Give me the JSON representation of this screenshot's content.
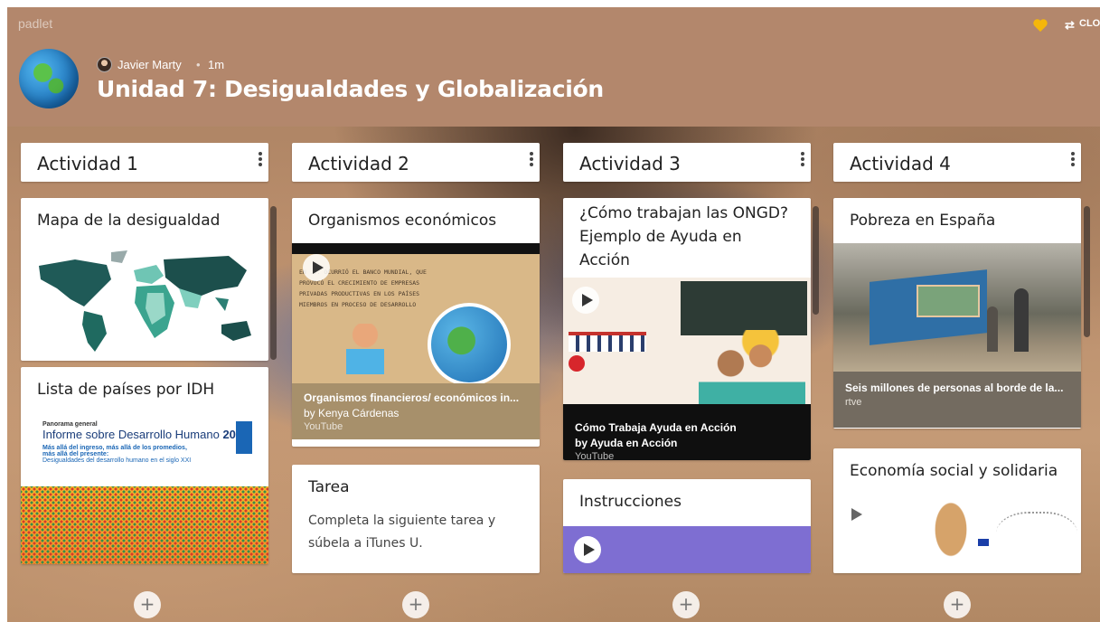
{
  "header": {
    "brand": "padlet",
    "remake_label": "CLO",
    "author": "Javier Marty",
    "separator": "•",
    "time": "1m",
    "title": "Unidad 7: Desigualdades y Globalización"
  },
  "columns": [
    {
      "title": "Actividad 1",
      "posts": [
        {
          "title": "Mapa de la desigualdad"
        },
        {
          "title": "Lista de países por IDH",
          "doc": {
            "kicker": "Panorama general",
            "heading": "Informe sobre Desarrollo Humano",
            "year": "2019",
            "line1": "Más allá del ingreso, más allá de los promedios,",
            "line2": "más allá del presente:",
            "line3": "Desigualdades del desarrollo humano en el siglo XXI"
          }
        }
      ]
    },
    {
      "title": "Actividad 2",
      "posts": [
        {
          "title": "Organismos económicos",
          "video_caption": "Organismos financieros/ económicos in...",
          "by": "by Kenya Cárdenas",
          "source": "YouTube",
          "thumb_text": "En ... ocurrió el Banco Mundial, que provocó el crecimiento de empresas privadas productivas en los países miembros en proceso de desarrollo"
        },
        {
          "title": "Tarea",
          "body": "Completa la siguiente tarea y súbela a iTunes U."
        }
      ]
    },
    {
      "title": "Actividad 3",
      "posts": [
        {
          "title": "¿Cómo trabajan las ONGD? Ejemplo de Ayuda en Acción",
          "video_caption": "Cómo Trabaja Ayuda en Acción",
          "by": "by Ayuda en Acción",
          "source": "YouTube"
        },
        {
          "title": "Instrucciones"
        }
      ]
    },
    {
      "title": "Actividad 4",
      "posts": [
        {
          "title": "Pobreza en España",
          "video_caption": "Seis millones de personas al borde de la...",
          "source": "rtve"
        },
        {
          "title": "Economía social y solidaria"
        }
      ]
    }
  ],
  "add_label": "+",
  "colors": {
    "header": "#b3876c",
    "heart": "#f5b70a",
    "audio_bar": "#7e6ed2",
    "video_bar": "#0f0f0f",
    "tan_bar": "#a7906b"
  }
}
